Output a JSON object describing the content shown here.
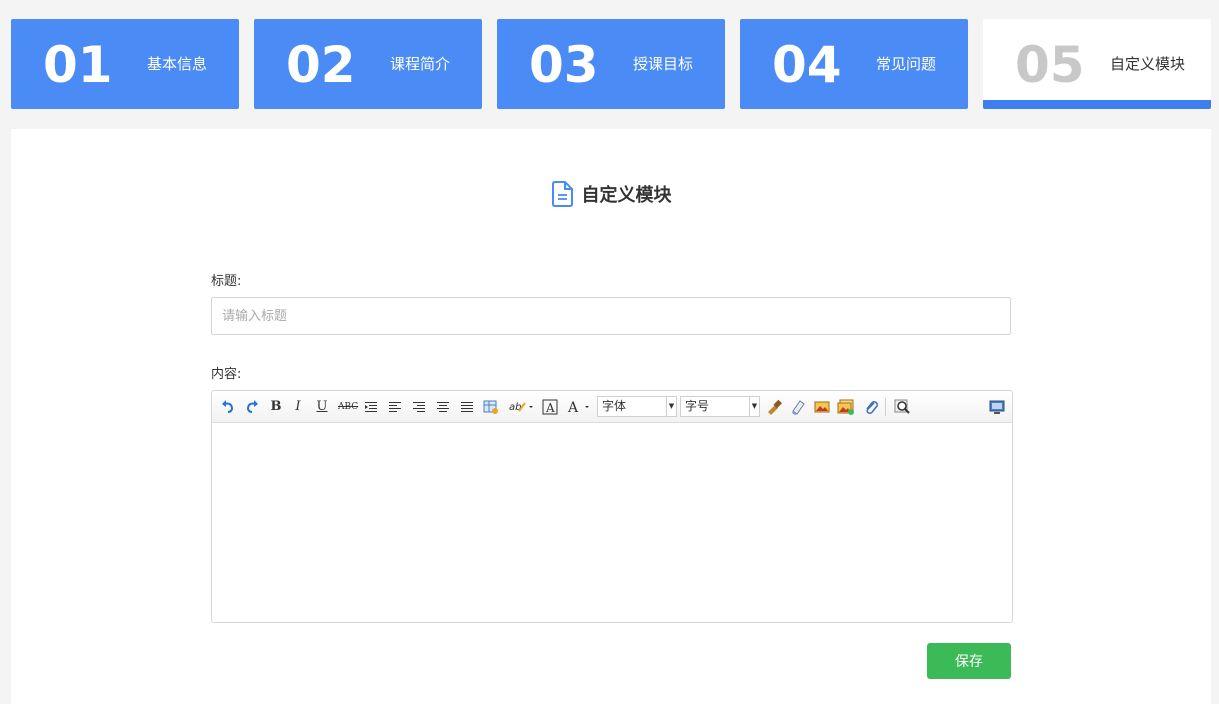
{
  "steps": [
    {
      "num": "01",
      "label": "基本信息",
      "active": false
    },
    {
      "num": "02",
      "label": "课程简介",
      "active": false
    },
    {
      "num": "03",
      "label": "授课目标",
      "active": false
    },
    {
      "num": "04",
      "label": "常见问题",
      "active": false
    },
    {
      "num": "05",
      "label": "自定义模块",
      "active": true
    }
  ],
  "main": {
    "page_title": "自定义模块",
    "title_label": "标题:",
    "title_placeholder": "请输入标题",
    "title_value": "",
    "content_label": "内容:",
    "save_label": "保存"
  },
  "editor": {
    "font_family_select": "字体",
    "font_size_select": "字号",
    "toolbar_icons": [
      "undo-icon",
      "redo-icon",
      "bold-icon",
      "italic-icon",
      "underline-icon",
      "strikethrough-icon",
      "outdent-icon",
      "align-left-icon",
      "align-right-icon",
      "align-center-icon",
      "align-justify-icon",
      "insert-table-icon",
      "highlight-color-icon",
      "text-border-icon",
      "font-color-icon",
      "format-brush-icon",
      "eraser-icon",
      "image-icon",
      "multi-image-icon",
      "attachment-icon",
      "search-replace-icon",
      "fullscreen-icon"
    ]
  },
  "colors": {
    "step_blue": "#4a8bf5",
    "step_active_bar": "#3d7ef0",
    "save_green": "#3dba58"
  }
}
